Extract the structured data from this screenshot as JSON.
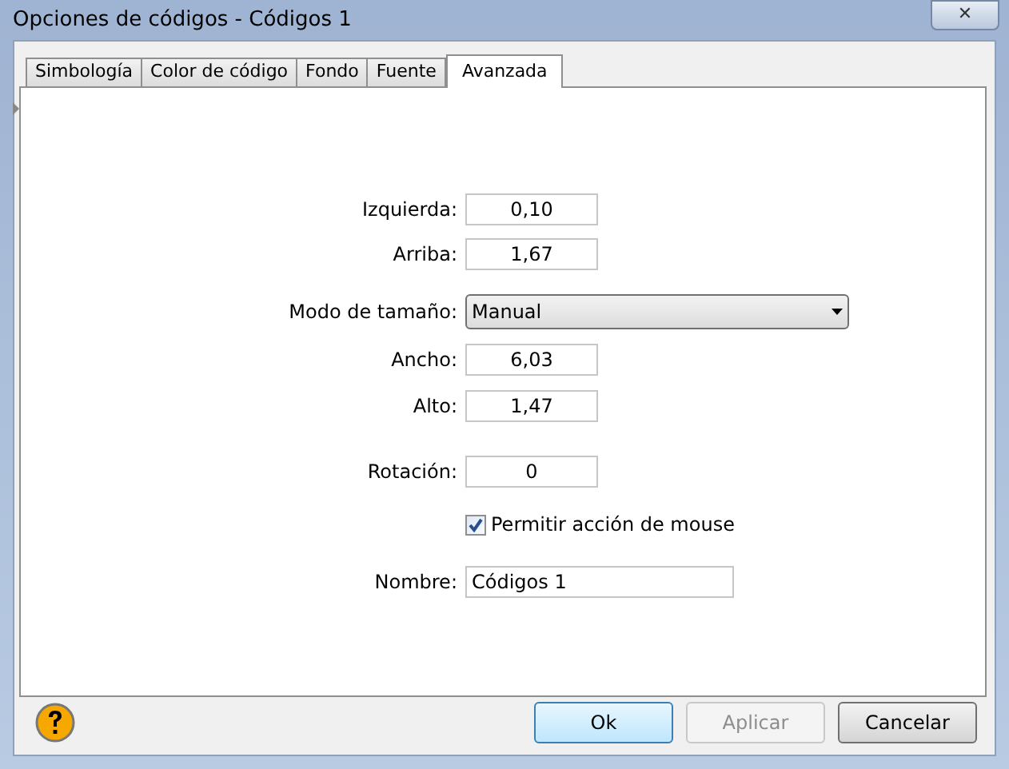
{
  "window": {
    "title": "Opciones de códigos - Códigos 1",
    "close": "✕"
  },
  "tabs": [
    {
      "label": "Simbología",
      "selected": false
    },
    {
      "label": "Color de código",
      "selected": false
    },
    {
      "label": "Fondo",
      "selected": false
    },
    {
      "label": "Fuente",
      "selected": false
    },
    {
      "label": "Avanzada",
      "selected": true
    }
  ],
  "fields": [
    {
      "kind": "number",
      "label": "Izquierda:",
      "value": "0,10"
    },
    {
      "kind": "number",
      "label": "Arriba:",
      "value": "1,67"
    },
    {
      "kind": "dropdown",
      "label": "Modo de tamaño:",
      "value": "Manual"
    },
    {
      "kind": "number",
      "label": "Ancho:",
      "value": "6,03"
    },
    {
      "kind": "number",
      "label": "Alto:",
      "value": "1,47"
    },
    {
      "kind": "number",
      "label": "Rotación:",
      "value": "0"
    },
    {
      "kind": "checkbox",
      "label": "Permitir acción de mouse",
      "checked": true
    },
    {
      "kind": "text",
      "label": "Nombre:",
      "value": "Códigos 1"
    }
  ],
  "buttons": [
    {
      "label": "Ok",
      "disabled": false,
      "default": true
    },
    {
      "label": "Aplicar",
      "disabled": true,
      "default": false
    },
    {
      "label": "Cancelar",
      "disabled": false,
      "default": false
    }
  ]
}
